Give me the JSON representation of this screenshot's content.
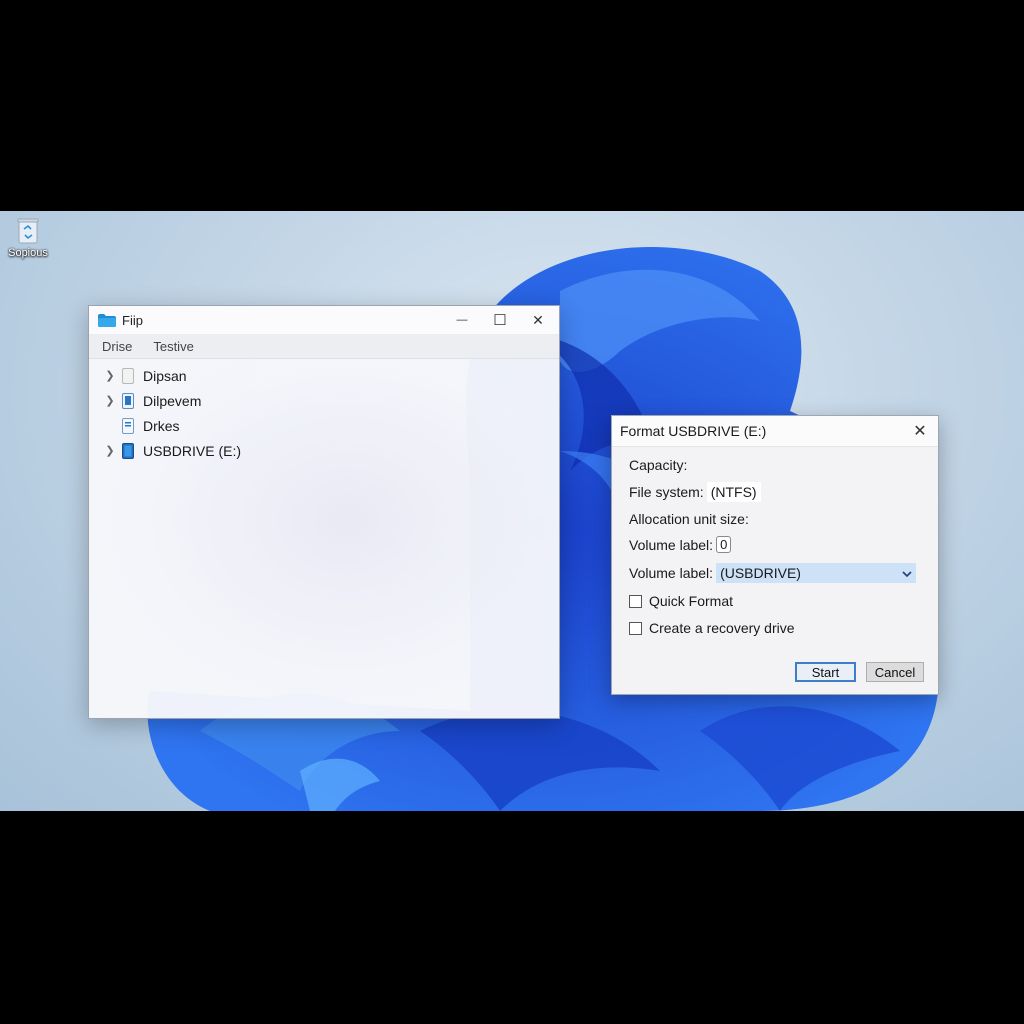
{
  "desktop": {
    "icon_label": "Sopious",
    "icon_name": "recycle-bin-icon"
  },
  "explorer": {
    "title": "Fiip",
    "app_icon": "folder-icon",
    "controls": {
      "minimize": "—",
      "maximize": "☐",
      "close": "✕"
    },
    "menu": [
      "Drise",
      "Testive"
    ],
    "tree": [
      {
        "label": "Dipsan",
        "expandable": true,
        "icon": "drive-icon"
      },
      {
        "label": "Dilpevem",
        "expandable": true,
        "icon": "drive-icon"
      },
      {
        "label": "Drkes",
        "expandable": false,
        "icon": "drive-icon"
      },
      {
        "label": "USBDRIVE (E:)",
        "expandable": true,
        "icon": "usb-drive-icon"
      }
    ]
  },
  "format_dialog": {
    "title": "Format USBDRIVE (E:)",
    "close": "✕",
    "capacity_label": "Capacity:",
    "filesystem_label": "File system:",
    "filesystem_value": "(NTFS)",
    "allocation_label": "Allocation unit size:",
    "volume_label_1": "Volume label:",
    "volume_value_1": "0",
    "volume_label_2": "Volume label:",
    "volume_value_2": "(USBDRIVE)",
    "quick_format": "Quick Format",
    "recovery_drive": "Create a recovery drive",
    "start": "Start",
    "cancel": "Cancel"
  },
  "colors": {
    "accent": "#1e56d8",
    "selection": "#cde1f7"
  }
}
